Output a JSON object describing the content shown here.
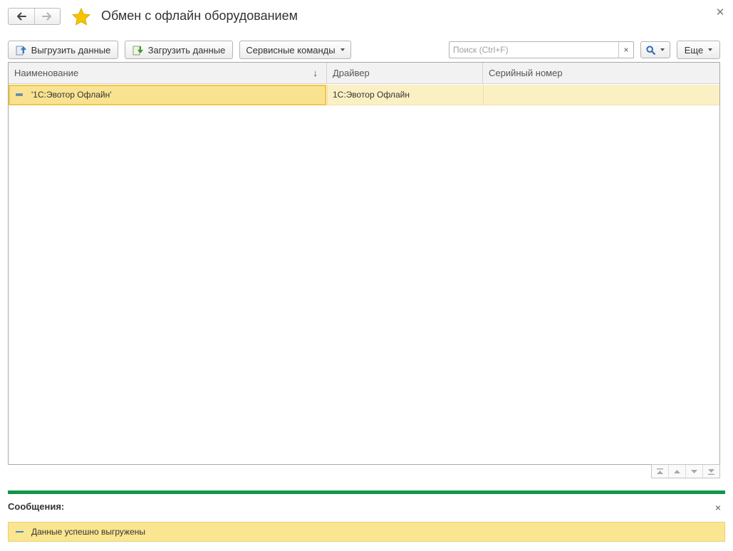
{
  "header": {
    "back_icon": "arrow-left-icon",
    "forward_icon": "arrow-right-icon",
    "favorite_icon": "star-icon",
    "title": "Обмен с офлайн оборудованием",
    "close_icon": "close-icon"
  },
  "toolbar": {
    "upload_label": "Выгрузить данные",
    "download_label": "Загрузить данные",
    "service_label": "Сервисные команды",
    "search_placeholder": "Поиск (Ctrl+F)",
    "search_value": "",
    "clear_glyph": "×",
    "more_label": "Еще"
  },
  "table": {
    "columns": [
      "Наименование",
      "Драйвер",
      "Серийный номер"
    ],
    "sort_glyph": "↓",
    "rows": [
      {
        "name": "'1С:Эвотор Офлайн'",
        "driver": "1С:Эвотор Офлайн",
        "serial": ""
      }
    ]
  },
  "messages": {
    "title": "Сообщения:",
    "close_glyph": "×",
    "items": [
      "Данные успешно выгружены"
    ]
  },
  "colors": {
    "accent_green": "#10964a",
    "row_selected": "#fbf0c4",
    "focus_cell": "#f9e391",
    "message_bg": "#fae590",
    "star": "#f5c400"
  }
}
